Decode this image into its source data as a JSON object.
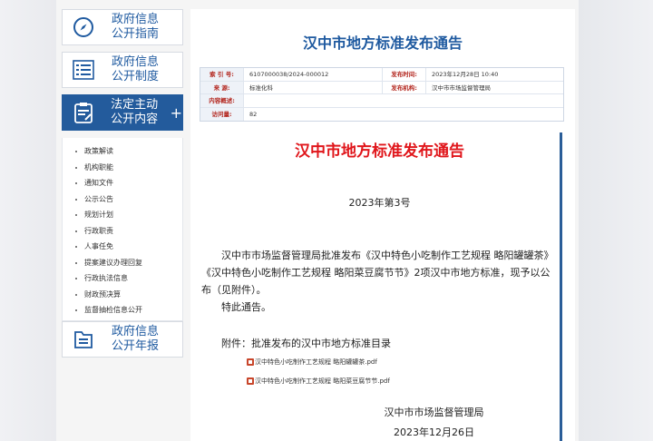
{
  "sidebar": {
    "cards": [
      {
        "label_line1": "政府信息",
        "label_line2": "公开指南",
        "icon": "compass-icon"
      },
      {
        "label_line1": "政府信息",
        "label_line2": "公开制度",
        "icon": "list-doc-icon"
      },
      {
        "label_line1": "法定主动",
        "label_line2": "公开内容",
        "icon": "clipboard-icon",
        "expand": "+"
      },
      {
        "label_line1": "政府信息",
        "label_line2": "公开年报",
        "icon": "folder-report-icon"
      }
    ],
    "submenu": [
      "政策解读",
      "机构职能",
      "通知文件",
      "公示公告",
      "规划计划",
      "行政职责",
      "人事任免",
      "提案建议办理回复",
      "行政执法信息",
      "财政预决算",
      "监督抽检信息公开"
    ]
  },
  "main": {
    "page_title": "汉中市地方标准发布通告",
    "meta": {
      "index_label": "索 引 号:",
      "index_value": "6107000038/2024-000012",
      "pubtime_label": "发布时间:",
      "pubtime_value": "2023年12月28日 10:40",
      "source_label": "来 源:",
      "source_value": "标准化科",
      "org_label": "发布机构:",
      "org_value": "汉中市市场监督管理局",
      "summary_label": "内容概述:",
      "summary_value": "",
      "visits_label": "访问量:",
      "visits_value": "82"
    },
    "article": {
      "title": "汉中市地方标准发布通告",
      "doc_no": "2023年第3号",
      "paragraph": "汉中市市场监督管理局批准发布《汉中特色小吃制作工艺规程 略阳罐罐茶》《汉中特色小吃制作工艺规程 略阳菜豆腐节节》2项汉中市地方标准，现予以公布（见附件）。",
      "paragraph2": "特此通告。",
      "attach_title": "附件：批准发布的汉中市地方标准目录",
      "attachments": [
        "汉中特色小吃制作工艺规程 略阳罐罐茶.pdf",
        "汉中特色小吃制作工艺规程 略阳菜豆腐节节.pdf"
      ],
      "sign_org": "汉中市市场监督管理局",
      "sign_date": "2023年12月26日"
    }
  },
  "colors": {
    "brand_blue": "#235b9c",
    "title_red": "#e0161b",
    "label_red": "#b3261e"
  }
}
